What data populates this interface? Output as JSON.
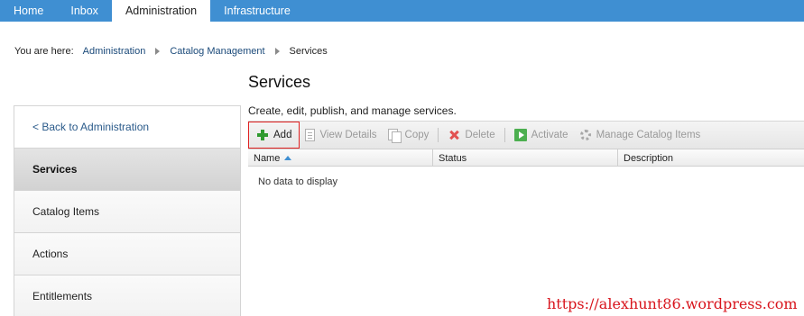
{
  "topnav": {
    "tabs": [
      {
        "label": "Home"
      },
      {
        "label": "Inbox"
      },
      {
        "label": "Administration"
      },
      {
        "label": "Infrastructure"
      }
    ],
    "active_index": 2
  },
  "breadcrumb": {
    "prefix": "You are here:",
    "items": [
      "Administration",
      "Catalog Management",
      "Services"
    ]
  },
  "page": {
    "title": "Services",
    "subtitle": "Create, edit, publish, and manage services."
  },
  "sidebar": {
    "back_label": "< Back to Administration",
    "items": [
      "Services",
      "Catalog Items",
      "Actions",
      "Entitlements"
    ],
    "active_index": 0
  },
  "toolbar": {
    "add": "Add",
    "view_details": "View Details",
    "copy": "Copy",
    "delete": "Delete",
    "activate": "Activate",
    "manage_catalog_items": "Manage Catalog Items"
  },
  "grid": {
    "columns": [
      "Name",
      "Status",
      "Description"
    ],
    "sort_column": "Name",
    "sort_direction": "ascending",
    "empty_message": "No data to display"
  },
  "watermark": "https://alexhunt86.wordpress.com",
  "colors": {
    "nav_blue": "#3f8fd2",
    "link_blue": "#1b4a7a",
    "add_highlight": "#e02020",
    "watermark_red": "#d8141c"
  }
}
